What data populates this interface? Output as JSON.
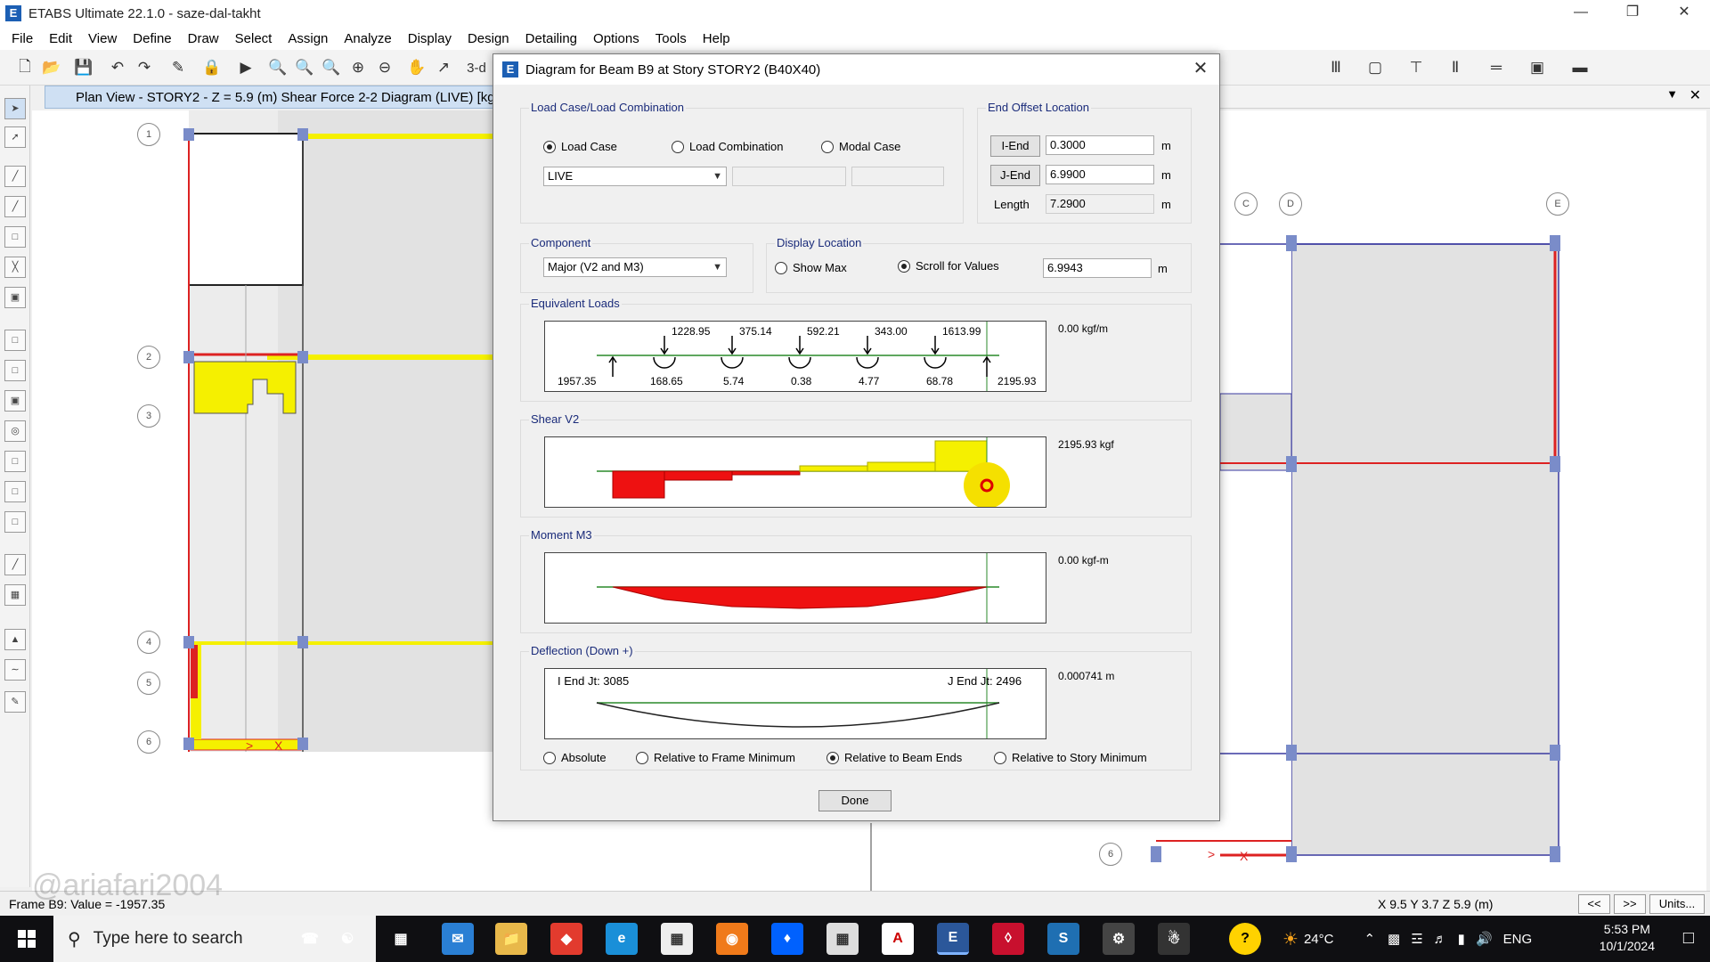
{
  "window": {
    "title": "ETABS Ultimate 22.1.0 - saze-dal-takht"
  },
  "menu": [
    "File",
    "Edit",
    "View",
    "Define",
    "Draw",
    "Select",
    "Assign",
    "Analyze",
    "Display",
    "Design",
    "Detailing",
    "Options",
    "Tools",
    "Help"
  ],
  "toolbar": {
    "label_3d": "3-d"
  },
  "view_tab": {
    "title": "Plan View - STORY2 - Z = 5.9 (m)    Shear Force 2-2 Diagram    (LIVE)  [kg"
  },
  "grid_bubbles_left": [
    "1",
    "2",
    "3",
    "4",
    "5",
    "6"
  ],
  "grid_bubbles_right": [
    "C",
    "D",
    "E",
    "6"
  ],
  "dialog": {
    "title": "Diagram for Beam B9 at Story STORY2 (B40X40)",
    "load_case_group": {
      "label": "Load Case/Load Combination",
      "options": [
        "Load Case",
        "Load Combination",
        "Modal Case"
      ],
      "selected": "Load Case",
      "case_value": "LIVE"
    },
    "end_offset": {
      "label": "End Offset Location",
      "i_end_label": "I-End",
      "i_end_value": "0.3000",
      "j_end_label": "J-End",
      "j_end_value": "6.9900",
      "length_label": "Length",
      "length_value": "7.2900",
      "unit": "m"
    },
    "component": {
      "label": "Component",
      "value": "Major (V2 and M3)"
    },
    "display_location": {
      "label": "Display Location",
      "show_max": "Show Max",
      "scroll": "Scroll for Values",
      "selected": "Scroll for Values",
      "value": "6.9943",
      "unit": "m"
    },
    "equivalent_loads": {
      "label": "Equivalent Loads",
      "readout": "0.00 kgf/m",
      "top_values": [
        "1228.95",
        "375.14",
        "592.21",
        "343.00",
        "1613.99"
      ],
      "moment_values": [
        "168.65",
        "5.74",
        "0.38",
        "4.77",
        "68.78"
      ],
      "left_reaction": "1957.35",
      "right_reaction": "2195.93"
    },
    "shear": {
      "label": "Shear V2",
      "readout": "2195.93 kgf"
    },
    "moment": {
      "label": "Moment M3",
      "readout": "0.00 kgf-m"
    },
    "deflection": {
      "label": "Deflection (Down +)",
      "readout": "0.000741 m",
      "i_end": "I End Jt: 3085",
      "j_end": "J End Jt: 2496"
    },
    "deflection_options": [
      "Absolute",
      "Relative to Frame Minimum",
      "Relative to Beam Ends",
      "Relative to Story Minimum"
    ],
    "deflection_selected": "Relative to Beam Ends",
    "done_label": "Done"
  },
  "status": {
    "left": "Frame B9:  Value = -1957.35",
    "watermark": "@ariafari2004",
    "coords": "X 9.5  Y 3.7  Z 5.9 (m)",
    "prev": "<<",
    "next": ">>",
    "units": "Units..."
  },
  "taskbar": {
    "search_placeholder": "Type here to search",
    "weather": "24°C",
    "lang": "ENG",
    "time": "5:53 PM",
    "date": "10/1/2024"
  }
}
